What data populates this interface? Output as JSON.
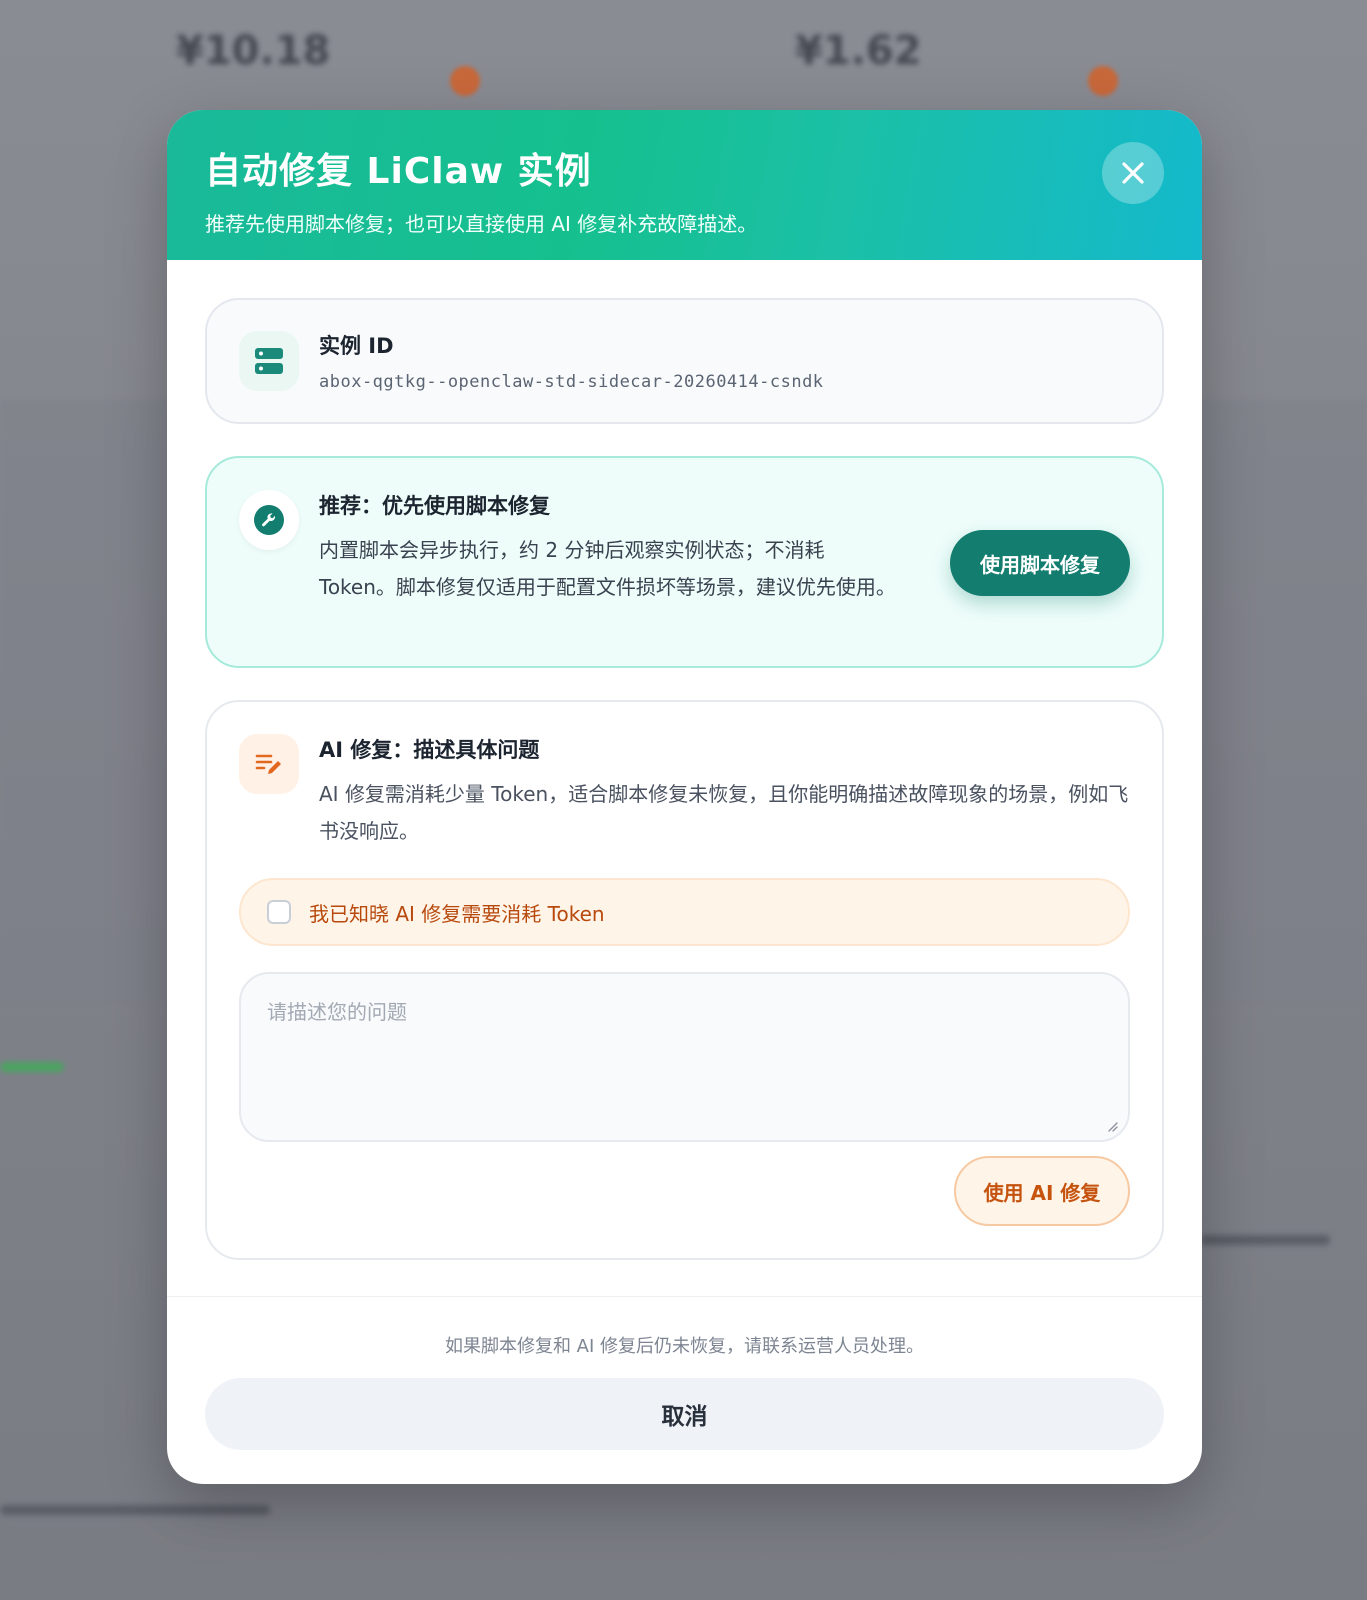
{
  "modal": {
    "title": "自动修复 LiClaw 实例",
    "subtitle": "推荐先使用脚本修复；也可以直接使用 AI 修复补充故障描述。"
  },
  "instance": {
    "label": "实例 ID",
    "value": "abox-qgtkg--openclaw-std-sidecar-20260414-csndk"
  },
  "script_repair": {
    "title": "推荐：优先使用脚本修复",
    "description": "内置脚本会异步执行，约 2 分钟后观察实例状态；不消耗 Token。脚本修复仅适用于配置文件损坏等场景，建议优先使用。",
    "button": "使用脚本修复"
  },
  "ai_repair": {
    "title": "AI 修复：描述具体问题",
    "description": "AI 修复需消耗少量 Token，适合脚本修复未恢复，且你能明确描述故障现象的场景，例如飞书没响应。",
    "ack_label": "我已知晓 AI 修复需要消耗 Token",
    "ack_checked": false,
    "issue_placeholder": "请描述您的问题",
    "issue_value": "",
    "button": "使用 AI 修复"
  },
  "footer": {
    "note": "如果脚本修复和 AI 修复后仍未恢复，请联系运营人员处理。",
    "cancel": "取消"
  },
  "background": {
    "price_left": "¥10.18",
    "price_right": "¥1.62"
  },
  "icons": {
    "close": "close-icon",
    "instance": "server-icon",
    "script": "wrench-icon",
    "ai": "edit-list-icon"
  },
  "colors": {
    "header_start": "#19b99a",
    "header_end": "#14b9cc",
    "primary": "#137d6f",
    "ai_accent": "#c5530e"
  }
}
